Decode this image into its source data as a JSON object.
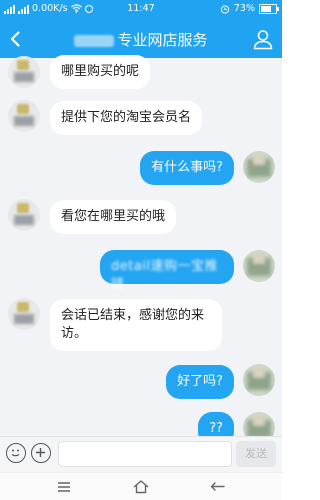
{
  "status_bar": {
    "network_speed": "0.00K/s",
    "time": "11:47",
    "battery": "73%"
  },
  "header": {
    "title": "专业网店服务"
  },
  "messages": [
    {
      "side": "left",
      "text": "哪里购买的呢"
    },
    {
      "side": "left",
      "text": "提供下您的淘宝会员名"
    },
    {
      "side": "right",
      "text": "有什么事吗?"
    },
    {
      "side": "left",
      "text": "看您在哪里买的哦"
    },
    {
      "side": "right",
      "text": "detail速购一宝推链"
    },
    {
      "side": "left",
      "text": "会话已结束，感谢您的来访。"
    },
    {
      "side": "right",
      "text": "好了吗?"
    },
    {
      "side": "right",
      "text": "??"
    }
  ],
  "input_bar": {
    "send_label": "发送"
  },
  "colors": {
    "accent": "#20a3f0",
    "bubble_right": "#24a5f2",
    "bubble_left": "#ffffff",
    "background": "#f1f3f6"
  },
  "icons": [
    "back-icon",
    "user-icon",
    "emoji-icon",
    "add-icon",
    "menu-icon",
    "home-icon",
    "return-icon"
  ]
}
